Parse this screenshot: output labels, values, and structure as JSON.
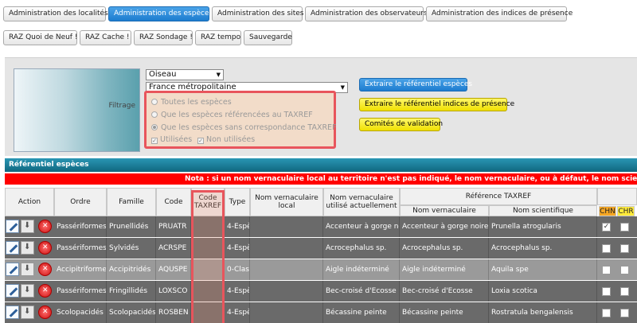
{
  "nav_tabs": [
    {
      "label": "Administration des localités"
    },
    {
      "label": "Administration des espèces"
    },
    {
      "label": "Administration des sites"
    },
    {
      "label": "Administration des observateurs"
    },
    {
      "label": "Administration des indices de présence"
    }
  ],
  "raz_buttons": [
    {
      "label": "RAZ Quoi de Neuf !"
    },
    {
      "label": "RAZ Cache !"
    },
    {
      "label": "RAZ Sondage !"
    },
    {
      "label": "RAZ tempo"
    },
    {
      "label": "Sauvegarde"
    }
  ],
  "filter": {
    "label": "Filtrage",
    "class_select": "Oiseau",
    "region_select": "France métropolitaine",
    "radios": [
      {
        "label": "Toutes les espèces",
        "checked": false
      },
      {
        "label": "Que les espèces référencées au TAXREF",
        "checked": false
      },
      {
        "label": "Que les espèces sans correspondance TAXREF",
        "checked": true
      }
    ],
    "checks": [
      {
        "label": "Utilisées",
        "checked": true
      },
      {
        "label": "Non utilisées",
        "checked": true
      }
    ]
  },
  "actions": {
    "extract_species": "Extraire le référentiel espèces",
    "extract_indices": "Extraire le référentiel indices de présence",
    "committees": "Comités de validation"
  },
  "section_title": "Référentiel espèces",
  "nota": "Nota : si un nom vernaculaire local au territoire n'est pas indiqué, le nom vernaculaire, ou à défaut, le nom scientifique d",
  "headers": {
    "action": "Action",
    "ordre": "Ordre",
    "famille": "Famille",
    "code": "Code",
    "code_taxref": "Code TAXREF",
    "type": "Type",
    "nom_local": "Nom vernaculaire local",
    "nom_utilise": "Nom vernaculaire utilisé actuellement",
    "ref_taxref": "Référence TAXREF",
    "nom_vern": "Nom vernaculaire",
    "nom_sci": "Nom scientifique",
    "chn": "CHN",
    "chr": "CHR"
  },
  "colors": {
    "accent_blue": "#1d7ccf",
    "alert_red": "#ff0000",
    "highlight_red": "#e8555c",
    "chn_orange": "#f5a623",
    "chr_yellow": "#ffeb3b"
  },
  "rows": [
    {
      "ordre": "Passériformes",
      "famille": "Prunellidés",
      "code": "PRUATR",
      "type": "4-Espèce",
      "nom_utilise": "Accenteur à gorge noire",
      "nom_vern": "Accenteur à gorge noire",
      "nom_sci": "Prunella atrogularis",
      "chn": true,
      "chr": false,
      "shade": "dark"
    },
    {
      "ordre": "Passériformes",
      "famille": "Sylvidés",
      "code": "ACRSPE",
      "type": "4-Espèce",
      "nom_utilise": "Acrocephalus sp.",
      "nom_vern": "Acrocephalus sp.",
      "nom_sci": "Acrocephalus sp.",
      "chn": false,
      "chr": false,
      "shade": "dark"
    },
    {
      "ordre": "Accipitriformes",
      "famille": "Accipitridés",
      "code": "AQUSPE",
      "type": "0-Classe",
      "nom_utilise": "Aigle indéterminé",
      "nom_vern": "Aigle indéterminé",
      "nom_sci": "Aquila spe",
      "chn": false,
      "chr": false,
      "shade": "light"
    },
    {
      "ordre": "Passériformes",
      "famille": "Fringillidés",
      "code": "LOXSCO",
      "type": "4-Espèce",
      "nom_utilise": "Bec-croisé d'Ecosse",
      "nom_vern": "Bec-croisé d'Ecosse",
      "nom_sci": "Loxia scotica",
      "chn": false,
      "chr": false,
      "shade": "dark"
    },
    {
      "ordre": "Scolopacidés",
      "famille": "Scolopacidés",
      "code": "ROSBEN",
      "type": "4-Espèce",
      "nom_utilise": "Bécassine peinte",
      "nom_vern": "Bécassine peinte",
      "nom_sci": "Rostratula bengalensis",
      "chn": false,
      "chr": false,
      "shade": "dark"
    }
  ]
}
